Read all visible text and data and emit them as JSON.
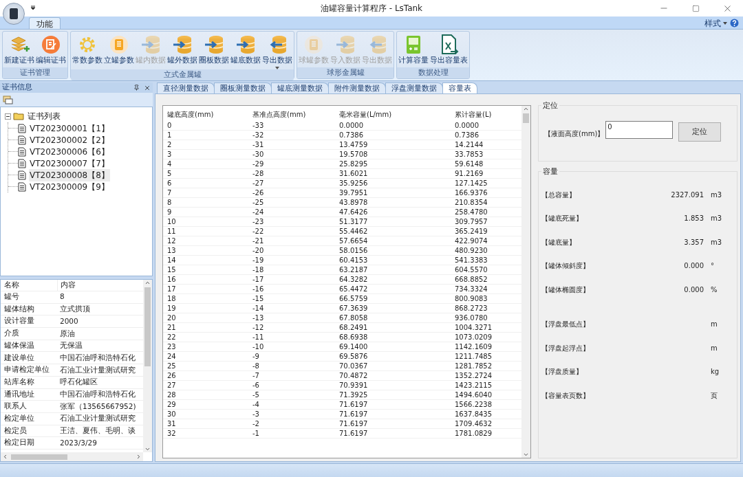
{
  "window": {
    "title": "油罐容量计算程序 - LsTank"
  },
  "ribbon": {
    "tabs": [
      {
        "label": "功能",
        "selected": true
      }
    ],
    "style_menu": "样式",
    "groups": [
      {
        "label": "证书管理",
        "buttons": [
          {
            "label": "新建证书",
            "kind": "layers",
            "disabled": false,
            "dropdown": false
          },
          {
            "label": "编辑证书",
            "kind": "edit",
            "disabled": false,
            "dropdown": false
          }
        ]
      },
      {
        "label": "立式金属罐",
        "buttons": [
          {
            "label": "常数参数",
            "kind": "gear",
            "disabled": false,
            "dropdown": false
          },
          {
            "label": "立罐参数",
            "kind": "list",
            "disabled": false,
            "dropdown": false
          },
          {
            "label": "罐内数据",
            "kind": "import",
            "disabled": true,
            "dropdown": false
          },
          {
            "label": "罐外数据",
            "kind": "import",
            "disabled": false,
            "dropdown": false
          },
          {
            "label": "圈板数据",
            "kind": "import",
            "disabled": false,
            "dropdown": false
          },
          {
            "label": "罐底数据",
            "kind": "import",
            "disabled": false,
            "dropdown": false
          },
          {
            "label": "导出数据",
            "kind": "export",
            "disabled": false,
            "dropdown": true
          }
        ]
      },
      {
        "label": "球形金属罐",
        "buttons": [
          {
            "label": "球罐参数",
            "kind": "list",
            "disabled": true,
            "dropdown": false
          },
          {
            "label": "导入数据",
            "kind": "import",
            "disabled": true,
            "dropdown": false
          },
          {
            "label": "导出数据",
            "kind": "export",
            "disabled": true,
            "dropdown": false
          }
        ]
      },
      {
        "label": "数据处理",
        "buttons": [
          {
            "label": "计算容量",
            "kind": "calc",
            "disabled": false,
            "dropdown": false
          },
          {
            "label": "导出容量表",
            "kind": "excel",
            "disabled": false,
            "dropdown": false
          }
        ]
      }
    ]
  },
  "cert_panel": {
    "title": "证书信息",
    "tree": {
      "label": "证书列表",
      "expanded": true,
      "children": [
        {
          "label": "VT202300001【1】",
          "selected": false
        },
        {
          "label": "VT202300002【2】",
          "selected": false
        },
        {
          "label": "VT202300006【6】",
          "selected": false
        },
        {
          "label": "VT202300007【7】",
          "selected": false
        },
        {
          "label": "VT202300008【8】",
          "selected": true
        },
        {
          "label": "VT202300009【9】",
          "selected": false
        }
      ]
    },
    "properties": {
      "columns": [
        "名称",
        "内容"
      ],
      "rows": [
        [
          "罐号",
          "8"
        ],
        [
          "罐体结构",
          "立式拱顶"
        ],
        [
          "设计容量",
          "2000"
        ],
        [
          "介质",
          "原油"
        ],
        [
          "罐体保温",
          "无保温"
        ],
        [
          "建设单位",
          "中国石油呼和浩特石化"
        ],
        [
          "申请检定单位",
          "石油工业计量测试研究"
        ],
        [
          "站库名称",
          "呼石化罐区"
        ],
        [
          "通讯地址",
          "中国石油呼和浩特石化"
        ],
        [
          "联系人",
          "张军（13565667952)"
        ],
        [
          "检定单位",
          "石油工业计量测试研究"
        ],
        [
          "检定员",
          "王洁、夏伟、毛明、谈"
        ],
        [
          "检定日期",
          "2023/3/29"
        ]
      ]
    }
  },
  "tabs": [
    {
      "label": "直径测量数据",
      "selected": false
    },
    {
      "label": "圈板测量数据",
      "selected": false
    },
    {
      "label": "罐底测量数据",
      "selected": false
    },
    {
      "label": "附件测量数据",
      "selected": false
    },
    {
      "label": "浮盘测量数据",
      "selected": false
    },
    {
      "label": "容量表",
      "selected": true
    }
  ],
  "table": {
    "columns": [
      "罐底高度(mm)",
      "基准点高度(mm)",
      "毫米容量(L/mm)",
      "累计容量(L)"
    ],
    "rows": [
      [
        "0",
        "-33",
        "0.0000",
        "0.0000"
      ],
      [
        "1",
        "-32",
        "0.7386",
        "0.7386"
      ],
      [
        "2",
        "-31",
        "13.4759",
        "14.2144"
      ],
      [
        "3",
        "-30",
        "19.5708",
        "33.7853"
      ],
      [
        "4",
        "-29",
        "25.8295",
        "59.6148"
      ],
      [
        "5",
        "-28",
        "31.6021",
        "91.2169"
      ],
      [
        "6",
        "-27",
        "35.9256",
        "127.1425"
      ],
      [
        "7",
        "-26",
        "39.7951",
        "166.9376"
      ],
      [
        "8",
        "-25",
        "43.8978",
        "210.8354"
      ],
      [
        "9",
        "-24",
        "47.6426",
        "258.4780"
      ],
      [
        "10",
        "-23",
        "51.3177",
        "309.7957"
      ],
      [
        "11",
        "-22",
        "55.4462",
        "365.2419"
      ],
      [
        "12",
        "-21",
        "57.6654",
        "422.9074"
      ],
      [
        "13",
        "-20",
        "58.0156",
        "480.9230"
      ],
      [
        "14",
        "-19",
        "60.4153",
        "541.3383"
      ],
      [
        "15",
        "-18",
        "63.2187",
        "604.5570"
      ],
      [
        "16",
        "-17",
        "64.3282",
        "668.8852"
      ],
      [
        "17",
        "-16",
        "65.4472",
        "734.3324"
      ],
      [
        "18",
        "-15",
        "66.5759",
        "800.9083"
      ],
      [
        "19",
        "-14",
        "67.3639",
        "868.2723"
      ],
      [
        "20",
        "-13",
        "67.8058",
        "936.0780"
      ],
      [
        "21",
        "-12",
        "68.2491",
        "1004.3271"
      ],
      [
        "22",
        "-11",
        "68.6938",
        "1073.0209"
      ],
      [
        "23",
        "-10",
        "69.1400",
        "1142.1609"
      ],
      [
        "24",
        "-9",
        "69.5876",
        "1211.7485"
      ],
      [
        "25",
        "-8",
        "70.0367",
        "1281.7852"
      ],
      [
        "26",
        "-7",
        "70.4872",
        "1352.2724"
      ],
      [
        "27",
        "-6",
        "70.9391",
        "1423.2115"
      ],
      [
        "28",
        "-5",
        "71.3925",
        "1494.6040"
      ],
      [
        "29",
        "-4",
        "71.6197",
        "1566.2238"
      ],
      [
        "30",
        "-3",
        "71.6197",
        "1637.8435"
      ],
      [
        "31",
        "-2",
        "71.6197",
        "1709.4632"
      ],
      [
        "32",
        "-1",
        "71.6197",
        "1781.0829"
      ]
    ]
  },
  "locate": {
    "title": "定位",
    "label": "【液面高度(mm)】",
    "value": "0",
    "button": "定位"
  },
  "capacity": {
    "title": "容量",
    "rows": [
      {
        "label": "【总容量】",
        "value": "2327.091",
        "unit": "m3"
      },
      {
        "label": "【罐底死量】",
        "value": "1.853",
        "unit": "m3"
      },
      {
        "label": "【罐底量】",
        "value": "3.357",
        "unit": "m3"
      },
      {
        "label": "【罐体倾斜度】",
        "value": "0.000",
        "unit": "°"
      },
      {
        "label": "【罐体椭圆度】",
        "value": "0.000",
        "unit": "%"
      },
      {
        "label": "【浮盘最低点】",
        "unit": "m"
      },
      {
        "label": "【浮盘起浮点】",
        "unit": "m"
      },
      {
        "label": "【浮盘质量】",
        "unit": "kg"
      },
      {
        "label": "【容量表页数】",
        "unit": "页"
      }
    ]
  }
}
